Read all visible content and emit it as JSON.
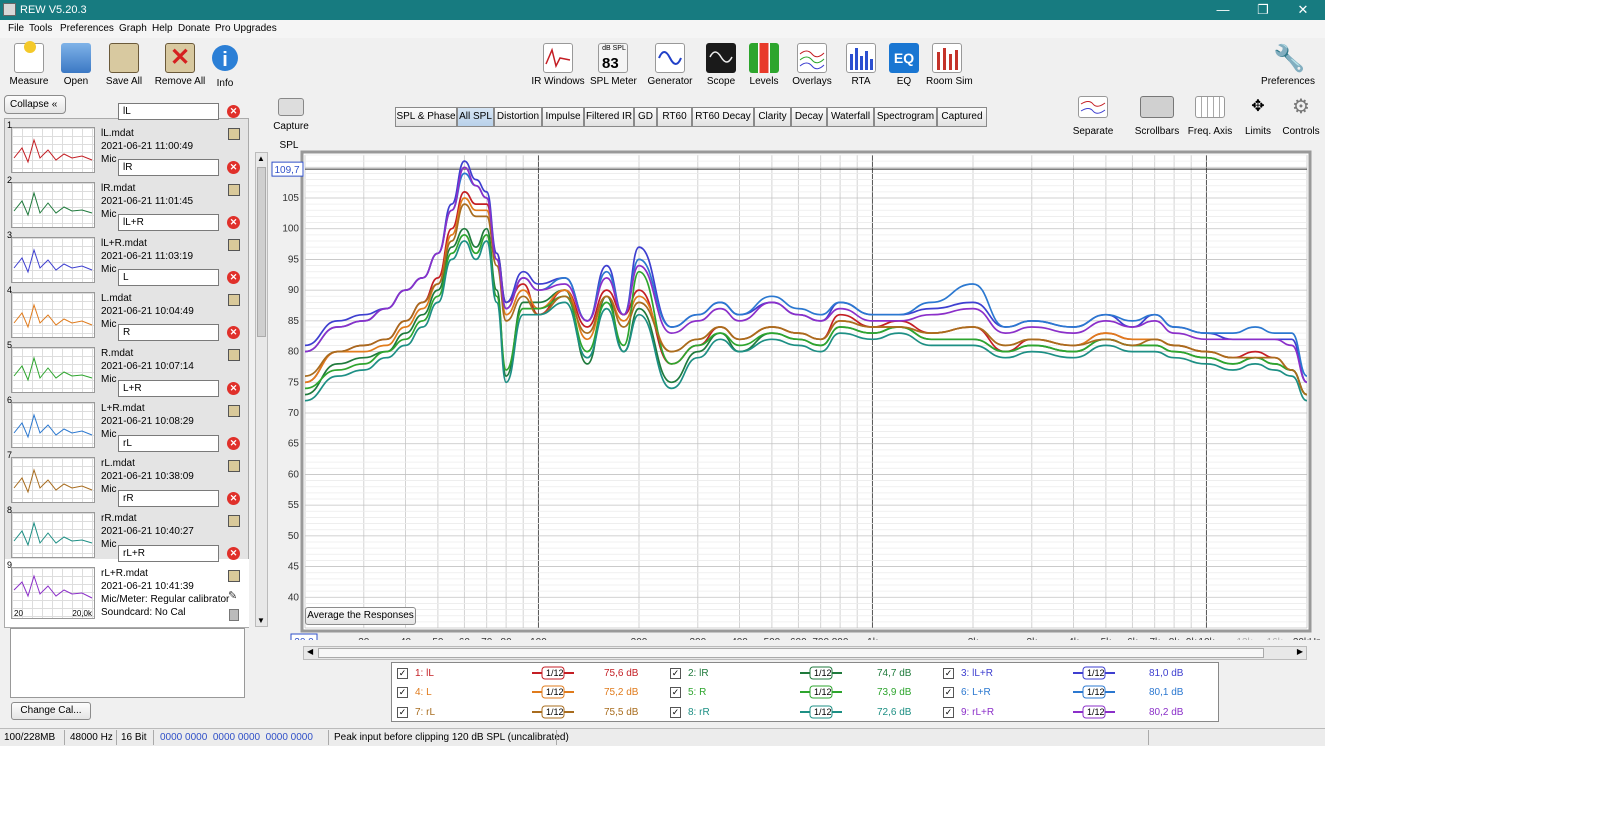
{
  "window": {
    "title": "REW V5.20.3"
  },
  "menu": [
    "File",
    "Tools",
    "Preferences",
    "Graph",
    "Help",
    "Donate",
    "Pro Upgrades"
  ],
  "toolbar_left": [
    {
      "label": "Measure",
      "icon": "measure-icon"
    },
    {
      "label": "Open",
      "icon": "folder-icon"
    },
    {
      "label": "Save All",
      "icon": "save-icon"
    },
    {
      "label": "Remove All",
      "icon": "remove-icon"
    },
    {
      "label": "Info",
      "icon": "info-icon"
    }
  ],
  "toolbar_center": [
    {
      "label": "IR Windows",
      "icon": "ir-windows-icon"
    },
    {
      "label": "SPL Meter",
      "icon": "spl-meter-icon",
      "value": "83",
      "unit": "dB SPL"
    },
    {
      "label": "Generator",
      "icon": "generator-icon"
    },
    {
      "label": "Scope",
      "icon": "scope-icon"
    },
    {
      "label": "Levels",
      "icon": "levels-icon"
    },
    {
      "label": "Overlays",
      "icon": "overlays-icon"
    },
    {
      "label": "RTA",
      "icon": "rta-icon"
    },
    {
      "label": "EQ",
      "icon": "eq-icon"
    },
    {
      "label": "Room Sim",
      "icon": "room-sim-icon"
    }
  ],
  "toolbar_right": {
    "label": "Preferences",
    "icon": "wrench-icon"
  },
  "graph_tools": [
    {
      "label": "Separate",
      "icon": "separate-icon"
    },
    {
      "label": "Scrollbars",
      "icon": "scrollbars-icon"
    },
    {
      "label": "Freq. Axis",
      "icon": "freq-axis-icon"
    },
    {
      "label": "Limits",
      "icon": "limits-icon"
    },
    {
      "label": "Controls",
      "icon": "gear-icon"
    }
  ],
  "capture": {
    "label": "Capture"
  },
  "collapse": {
    "label": "Collapse"
  },
  "tabs": [
    "SPL & Phase",
    "All SPL",
    "Distortion",
    "Impulse",
    "Filtered IR",
    "GD",
    "RT60",
    "RT60 Decay",
    "Clarity",
    "Decay",
    "Waterfall",
    "Spectrogram",
    "Captured"
  ],
  "active_tab": "All SPL",
  "measurements": [
    {
      "num": "1",
      "name": "lL",
      "file": "lL.mdat",
      "date": "2021-06-21 11:00:49",
      "color": "#c41e24"
    },
    {
      "num": "2",
      "name": "lR",
      "file": "lR.mdat",
      "date": "2021-06-21 11:01:45",
      "color": "#1f7a3c"
    },
    {
      "num": "3",
      "name": "lL+R",
      "file": "lL+R.mdat",
      "date": "2021-06-21 11:03:19",
      "color": "#3e3fd0"
    },
    {
      "num": "4",
      "name": "L",
      "file": "L.mdat",
      "date": "2021-06-21 10:04:49",
      "color": "#e07b1c"
    },
    {
      "num": "5",
      "name": "R",
      "file": "R.mdat",
      "date": "2021-06-21 10:07:14",
      "color": "#2ea52e"
    },
    {
      "num": "6",
      "name": "L+R",
      "file": "L+R.mdat",
      "date": "2021-06-21 10:08:29",
      "color": "#2b78d0"
    },
    {
      "num": "7",
      "name": "rL",
      "file": "rL.mdat",
      "date": "2021-06-21 10:38:09",
      "color": "#a86c1e"
    },
    {
      "num": "8",
      "name": "rR",
      "file": "rR.mdat",
      "date": "2021-06-21 10:40:27",
      "color": "#1d8f84"
    },
    {
      "num": "9",
      "name": "rL+R",
      "file": "rL+R.mdat",
      "date": "2021-06-21 10:41:39",
      "color": "#8b2fc9",
      "mic": "Mic/Meter: Regular calibrator",
      "card": "Soundcard: No Cal",
      "thumb_min": "20",
      "thumb_max": "20,0k"
    }
  ],
  "mic_prefix": "Mic",
  "change_cal": {
    "label": "Change Cal..."
  },
  "average_button": {
    "label": "Average the Responses"
  },
  "legend": [
    {
      "check": "✓",
      "label": "1: lL",
      "smoothing": "1/12",
      "level": "75,6 dB",
      "color": "#c41e24"
    },
    {
      "check": "✓",
      "label": "2: lR",
      "smoothing": "1/12",
      "level": "74,7 dB",
      "color": "#1f7a3c"
    },
    {
      "check": "✓",
      "label": "3: lL+R",
      "smoothing": "1/12",
      "level": "81,0 dB",
      "color": "#3e3fd0"
    },
    {
      "check": "✓",
      "label": "4: L",
      "smoothing": "1/12",
      "level": "75,2 dB",
      "color": "#e07b1c"
    },
    {
      "check": "✓",
      "label": "5: R",
      "smoothing": "1/12",
      "level": "73,9 dB",
      "color": "#2ea52e"
    },
    {
      "check": "✓",
      "label": "6: L+R",
      "smoothing": "1/12",
      "level": "80,1 dB",
      "color": "#2b78d0"
    },
    {
      "check": "✓",
      "label": "7: rL",
      "smoothing": "1/12",
      "level": "75,5 dB",
      "color": "#a86c1e"
    },
    {
      "check": "✓",
      "label": "8: rR",
      "smoothing": "1/12",
      "level": "72,6 dB",
      "color": "#1d8f84"
    },
    {
      "check": "✓",
      "label": "9: rL+R",
      "smoothing": "1/12",
      "level": "80,2 dB",
      "color": "#8b2fc9"
    }
  ],
  "status": {
    "memory": "100/228MB",
    "rate": "48000 Hz",
    "bits": "16 Bit",
    "levels": "0000 0000  0000 0000  0000 0000",
    "message": "Peak input before clipping 120 dB SPL (uncalibrated)"
  },
  "chart_data": {
    "type": "line",
    "ylabel": "SPL",
    "x_scale": "log",
    "xlim": [
      20,
      20000
    ],
    "ylim": [
      35,
      112
    ],
    "cursor_y": "109,7",
    "cursor_x": "20,0",
    "y_ticks": [
      "40",
      "45",
      "50",
      "55",
      "60",
      "65",
      "70",
      "75",
      "80",
      "85",
      "90",
      "95",
      "100",
      "105"
    ],
    "x_ticks": [
      {
        "v": 30,
        "t": "30"
      },
      {
        "v": 40,
        "t": "40"
      },
      {
        "v": 50,
        "t": "50"
      },
      {
        "v": 60,
        "t": "60"
      },
      {
        "v": 70,
        "t": "70"
      },
      {
        "v": 80,
        "t": "80"
      },
      {
        "v": 100,
        "t": "100"
      },
      {
        "v": 200,
        "t": "200"
      },
      {
        "v": 300,
        "t": "300"
      },
      {
        "v": 400,
        "t": "400"
      },
      {
        "v": 500,
        "t": "500"
      },
      {
        "v": 600,
        "t": "600"
      },
      {
        "v": 700,
        "t": "700"
      },
      {
        "v": 800,
        "t": "800"
      },
      {
        "v": 1000,
        "t": "1k"
      },
      {
        "v": 2000,
        "t": "2k"
      },
      {
        "v": 3000,
        "t": "3k"
      },
      {
        "v": 4000,
        "t": "4k"
      },
      {
        "v": 5000,
        "t": "5k"
      },
      {
        "v": 6000,
        "t": "6k"
      },
      {
        "v": 7000,
        "t": "7k"
      },
      {
        "v": 8000,
        "t": "8k"
      },
      {
        "v": 9000,
        "t": "9k"
      },
      {
        "v": 10000,
        "t": "10k"
      },
      {
        "v": 13000,
        "t": "13k"
      },
      {
        "v": 16000,
        "t": "16k"
      },
      {
        "v": 20000,
        "t": "20kHz"
      }
    ],
    "x": [
      20,
      25,
      30,
      35,
      40,
      45,
      50,
      55,
      60,
      65,
      70,
      75,
      80,
      90,
      100,
      120,
      140,
      160,
      180,
      200,
      250,
      300,
      350,
      400,
      500,
      600,
      700,
      800,
      1000,
      1200,
      1500,
      2000,
      2500,
      3000,
      4000,
      5000,
      6000,
      7000,
      8000,
      10000,
      12000,
      14000,
      16000,
      18000,
      20000
    ],
    "series": [
      {
        "name": "1: lL",
        "color": "#c41e24",
        "values": [
          75,
          80,
          81,
          82,
          85,
          88,
          92,
          100,
          106,
          104,
          104,
          96,
          88,
          91,
          86,
          90,
          84,
          90,
          86,
          90,
          78,
          81,
          84,
          82,
          84,
          83,
          82,
          86,
          84,
          85,
          83,
          84,
          80,
          82,
          81,
          83,
          82,
          82,
          81,
          80,
          79,
          80,
          79,
          77,
          73
        ]
      },
      {
        "name": "2: lR",
        "color": "#1f7a3c",
        "values": [
          73,
          78,
          79,
          80,
          83,
          86,
          90,
          97,
          100,
          97,
          100,
          90,
          76,
          88,
          88,
          90,
          78,
          89,
          80,
          87,
          75,
          80,
          83,
          80,
          83,
          82,
          81,
          84,
          83,
          84,
          82,
          82,
          80,
          81,
          80,
          82,
          81,
          81,
          80,
          79,
          78,
          79,
          78,
          77,
          73
        ]
      },
      {
        "name": "3: lL+R",
        "color": "#3e3fd0",
        "values": [
          81,
          85,
          86,
          87,
          90,
          92,
          96,
          104,
          111,
          108,
          106,
          96,
          88,
          93,
          91,
          92,
          85,
          94,
          86,
          97,
          84,
          86,
          88,
          86,
          88,
          86,
          85,
          88,
          86,
          86,
          87,
          88,
          84,
          85,
          84,
          86,
          84,
          86,
          84,
          83,
          82,
          82,
          82,
          82,
          75
        ]
      },
      {
        "name": "4: L",
        "color": "#e07b1c",
        "values": [
          75,
          80,
          80,
          81,
          84,
          87,
          91,
          99,
          105,
          103,
          103,
          95,
          86,
          90,
          87,
          90,
          82,
          89,
          85,
          89,
          80,
          82,
          84,
          82,
          84,
          83,
          82,
          85,
          84,
          84,
          83,
          84,
          81,
          82,
          81,
          83,
          82,
          82,
          81,
          80,
          79,
          79,
          79,
          77,
          73
        ]
      },
      {
        "name": "5: R",
        "color": "#2ea52e",
        "values": [
          74,
          77,
          78,
          80,
          82,
          85,
          89,
          96,
          99,
          96,
          99,
          89,
          77,
          87,
          87,
          89,
          80,
          88,
          81,
          93,
          78,
          81,
          83,
          81,
          83,
          82,
          81,
          84,
          83,
          84,
          82,
          82,
          80,
          81,
          80,
          82,
          81,
          81,
          80,
          79,
          78,
          79,
          78,
          77,
          73
        ]
      },
      {
        "name": "6: L+R",
        "color": "#2b78d0",
        "values": [
          80,
          84,
          85,
          87,
          90,
          92,
          96,
          103,
          109,
          107,
          105,
          95,
          87,
          92,
          90,
          92,
          85,
          93,
          86,
          95,
          84,
          86,
          88,
          86,
          89,
          87,
          86,
          88,
          86,
          86,
          88,
          91,
          84,
          85,
          84,
          86,
          85,
          86,
          84,
          83,
          83,
          84,
          83,
          83,
          76
        ]
      },
      {
        "name": "7: rL",
        "color": "#a86c1e",
        "values": [
          76,
          80,
          81,
          82,
          85,
          88,
          91,
          98,
          104,
          102,
          102,
          94,
          85,
          89,
          86,
          89,
          83,
          89,
          84,
          88,
          80,
          82,
          84,
          82,
          84,
          83,
          82,
          85,
          84,
          84,
          83,
          84,
          81,
          82,
          81,
          82,
          81,
          82,
          81,
          80,
          79,
          79,
          79,
          77,
          73
        ]
      },
      {
        "name": "8: rR",
        "color": "#1d8f84",
        "values": [
          72,
          76,
          77,
          79,
          81,
          84,
          88,
          95,
          98,
          95,
          98,
          88,
          75,
          86,
          86,
          88,
          79,
          87,
          80,
          86,
          74,
          79,
          82,
          80,
          82,
          81,
          80,
          83,
          82,
          83,
          81,
          81,
          79,
          80,
          79,
          81,
          80,
          80,
          79,
          78,
          77,
          78,
          77,
          76,
          72
        ]
      },
      {
        "name": "9: rL+R",
        "color": "#8b2fc9",
        "values": [
          80,
          84,
          85,
          87,
          90,
          92,
          96,
          103,
          110,
          107,
          105,
          95,
          87,
          92,
          90,
          91,
          85,
          92,
          86,
          94,
          83,
          85,
          87,
          85,
          88,
          86,
          85,
          87,
          85,
          85,
          86,
          87,
          83,
          84,
          83,
          85,
          84,
          85,
          83,
          82,
          82,
          82,
          82,
          81,
          75
        ]
      }
    ]
  }
}
